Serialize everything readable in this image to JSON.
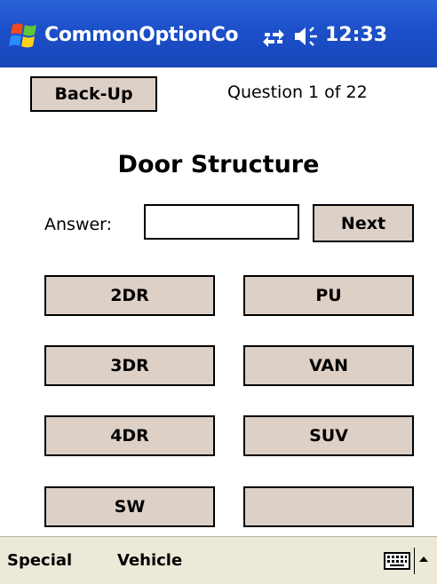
{
  "titlebar": {
    "app_title": "CommonOptionCo",
    "clock": "12:33",
    "icons": [
      "windows-start-icon",
      "connectivity-icon",
      "volume-icon"
    ]
  },
  "header": {
    "back_label": "Back-Up",
    "question_counter": "Question 1 of 22"
  },
  "main": {
    "title": "Door Structure",
    "answer_label": "Answer:",
    "answer_value": "",
    "next_label": "Next",
    "options": [
      "2DR",
      "PU",
      "3DR",
      "VAN",
      "4DR",
      "SUV",
      "SW",
      ""
    ]
  },
  "menubar": {
    "special_label": "Special",
    "vehicle_label": "Vehicle",
    "icons": [
      "keyboard-icon",
      "sip-arrow-up-icon"
    ]
  },
  "colors": {
    "titlebar_blue": "#1c4fc9",
    "button_face": "#ddd0c6",
    "menubar_bg": "#ece9d8"
  }
}
